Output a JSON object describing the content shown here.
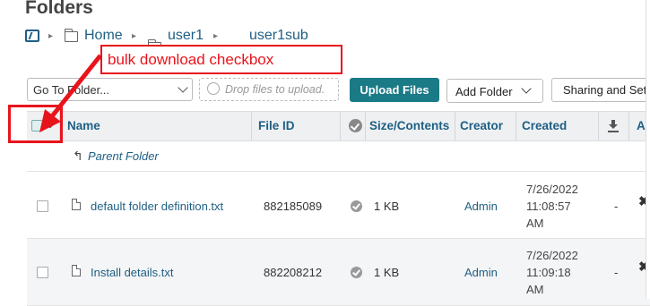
{
  "page": {
    "title": "Folders"
  },
  "breadcrumb": {
    "separator": "▸",
    "items": [
      {
        "label": "Home"
      },
      {
        "label": "user1"
      },
      {
        "label": "user1sub"
      }
    ]
  },
  "toolbar": {
    "goto_folder_value": "Go To Folder...",
    "drop_placeholder": "Drop files to upload.",
    "upload_label": "Upload Files",
    "add_folder_label": "Add Folder",
    "sharing_label": "Sharing and Sett"
  },
  "table": {
    "columns": [
      "Name",
      "File ID",
      "Size/Contents",
      "Creator",
      "Created",
      "Ac"
    ],
    "parent_folder_label": "Parent Folder",
    "rows": [
      {
        "name": "default folder definition.txt",
        "file_id": "882185089",
        "size": "1 KB",
        "creator": "Admin",
        "created_date": "7/26/2022",
        "created_time": "11:08:57",
        "created_ampm": "AM",
        "extra": "-"
      },
      {
        "name": "Install details.txt",
        "file_id": "882208212",
        "size": "1 KB",
        "creator": "Admin",
        "created_date": "7/26/2022",
        "created_time": "11:09:18",
        "created_ampm": "AM",
        "extra": "-"
      }
    ]
  },
  "annotation": {
    "text": "bulk download checkbox",
    "color": "#e8141c"
  },
  "colors": {
    "accent": "#1a7a86",
    "link": "#1e5f84",
    "annotation": "#e8141c"
  }
}
